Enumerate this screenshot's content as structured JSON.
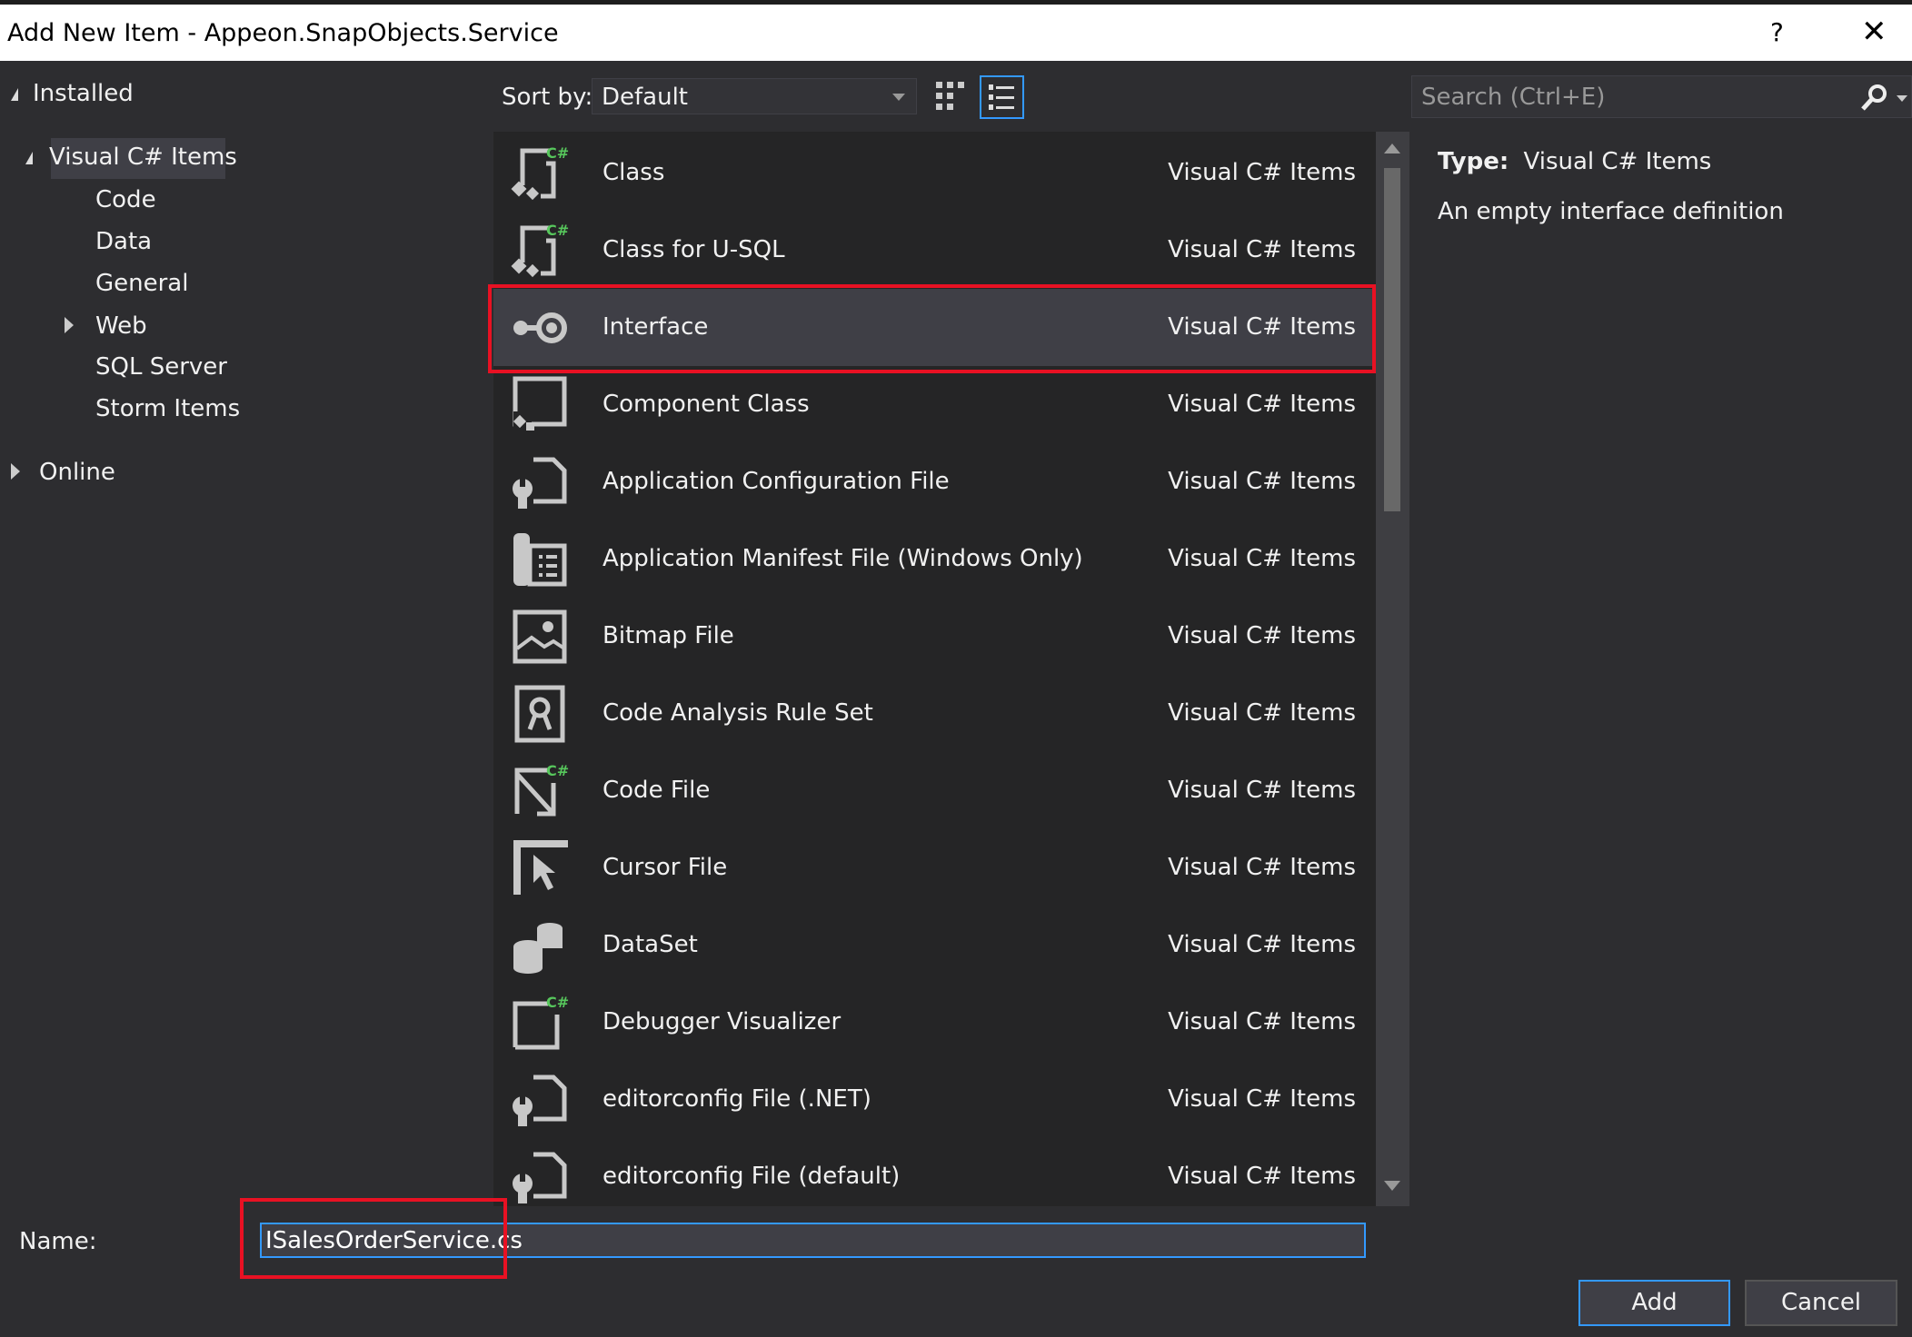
{
  "window": {
    "title": "Add New Item - Appeon.SnapObjects.Service",
    "help": "?",
    "close": "✕"
  },
  "tree": {
    "installed": "Installed",
    "root": "Visual C# Items",
    "children": [
      "Code",
      "Data",
      "General",
      "Web",
      "SQL Server",
      "Storm Items"
    ],
    "online": "Online"
  },
  "toolbar": {
    "sort_label": "Sort by:",
    "sort_value": "Default",
    "search_placeholder": "Search (Ctrl+E)"
  },
  "items": [
    {
      "name": "Class",
      "category": "Visual C# Items",
      "icon": "class-icon"
    },
    {
      "name": "Class for U-SQL",
      "category": "Visual C# Items",
      "icon": "class-icon"
    },
    {
      "name": "Interface",
      "category": "Visual C# Items",
      "icon": "interface-icon"
    },
    {
      "name": "Component Class",
      "category": "Visual C# Items",
      "icon": "component-icon"
    },
    {
      "name": "Application Configuration File",
      "category": "Visual C# Items",
      "icon": "config-file-icon"
    },
    {
      "name": "Application Manifest File (Windows Only)",
      "category": "Visual C# Items",
      "icon": "manifest-icon"
    },
    {
      "name": "Bitmap File",
      "category": "Visual C# Items",
      "icon": "bitmap-icon"
    },
    {
      "name": "Code Analysis Rule Set",
      "category": "Visual C# Items",
      "icon": "ruleset-icon"
    },
    {
      "name": "Code File",
      "category": "Visual C# Items",
      "icon": "code-file-icon"
    },
    {
      "name": "Cursor File",
      "category": "Visual C# Items",
      "icon": "cursor-icon"
    },
    {
      "name": "DataSet",
      "category": "Visual C# Items",
      "icon": "dataset-icon"
    },
    {
      "name": "Debugger Visualizer",
      "category": "Visual C# Items",
      "icon": "visualizer-icon"
    },
    {
      "name": "editorconfig File (.NET)",
      "category": "Visual C# Items",
      "icon": "config-file-icon"
    },
    {
      "name": "editorconfig File (default)",
      "category": "Visual C# Items",
      "icon": "config-file-icon"
    }
  ],
  "selected_index": 2,
  "details": {
    "type_label": "Type:",
    "type_value": "Visual C# Items",
    "description": "An empty interface definition"
  },
  "footer": {
    "name_label": "Name:",
    "name_value": "ISalesOrderService.cs",
    "add": "Add",
    "cancel": "Cancel"
  },
  "colors": {
    "accent": "#3399ff",
    "highlight": "#e81123",
    "csharp_badge": "#57c75c"
  }
}
